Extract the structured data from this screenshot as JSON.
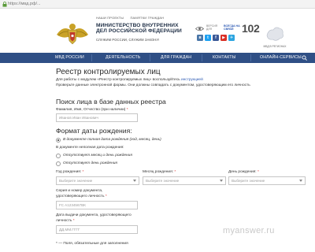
{
  "browser": {
    "url": "https://мвд.рф/..."
  },
  "header": {
    "top_links": [
      "НАШИ ПРОЕКТЫ",
      "ПАМЯТКИ ГРАЖДАН"
    ],
    "ministry_name": "МИНИСТЕРСТВО ВНУТРЕННИХ ДЕЛ РОССИЙСКОЙ ФЕДЕРАЦИИ",
    "slogan": "СЛУЖИМ РОССИИ, СЛУЖИМ ЗАКОНУ!",
    "version_label": "ВЕРСИЯ ДЛЯ",
    "phone_caption": "ВСЕГДА НА СВЯЗИ",
    "phone_number": "102",
    "region_caption": "МВД В РЕГИОНАХ",
    "social": [
      {
        "icon": "vk-icon",
        "glyph": "в",
        "color": "#4a76a8"
      },
      {
        "icon": "twitter-icon",
        "glyph": "t",
        "color": "#1da1f2"
      },
      {
        "icon": "facebook-icon",
        "glyph": "f",
        "color": "#3b5998"
      },
      {
        "icon": "youtube-icon",
        "glyph": "▶",
        "color": "#d93025"
      },
      {
        "icon": "telegram-icon",
        "glyph": "✈",
        "color": "#2ca5e0"
      }
    ]
  },
  "nav": {
    "items": [
      "МВД РОССИИ",
      "ДЕЯТЕЛЬНОСТЬ",
      "ДЛЯ ГРАЖДАН",
      "КОНТАКТЫ",
      "ОНЛАЙН-СЕРВИСЫ"
    ],
    "color": "#2f4f85"
  },
  "page": {
    "title": "Реестр контролируемых лиц",
    "intro_text": "Для работы с модулем «Реестр контролируемых лиц» воспользуйтесь",
    "intro_link": "инструкцией",
    "check_note": "Проверьте данные электронной формы. Они должны совпадать с документом, удостоверяющим его личность",
    "search_heading": "Поиск лица в базе данных реестра",
    "fio_label": "Фамилия, Имя, Отчество (при наличии)",
    "fio_req": "*",
    "fio_placeholder": "Иванов Иван Иванович",
    "dob_heading": "Формат даты рождения:",
    "radio_full": "В документе полная дата рождения (год, месяц, день)",
    "partial_label": "В документе неполная дата рождения:",
    "radio_no_month_day": "Отсутствует месяц и день рождения",
    "radio_no_day": "Отсутствует день рождения",
    "year_label": "Год рождения:",
    "month_label": "Месяц рождения:",
    "day_label": "День рождения:",
    "req_mark": "*",
    "select_placeholder": "Выберите значение",
    "doc_label_1": "Серия и номер документа,",
    "doc_label_2": "удостоверяющего личность",
    "doc_placeholder": "FC A1234567BK",
    "issue_label_1": "Дата выдачи документа, удостоверяющего",
    "issue_label_2": "личность",
    "issue_placeholder": "ДД.ММ.ГГГГ",
    "required_note": "* — Поля, обязательные для заполнения"
  },
  "watermark": "myanswer.ru"
}
